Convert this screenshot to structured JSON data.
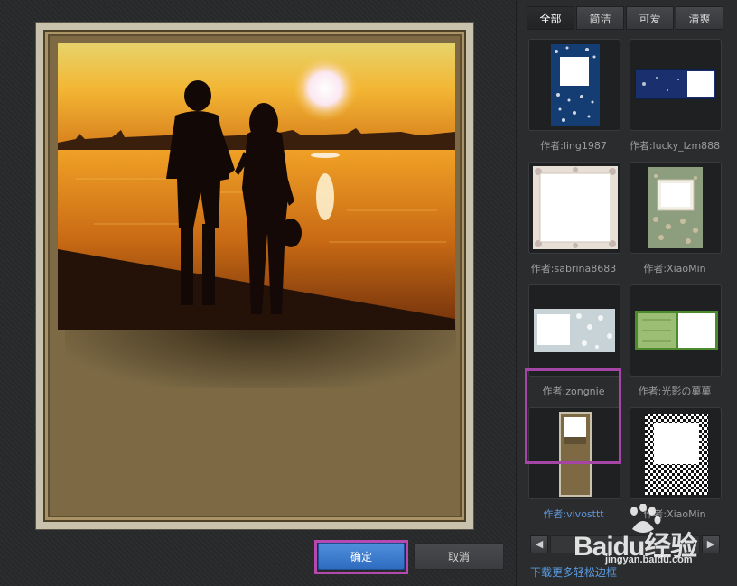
{
  "buttons": {
    "confirm": "确定",
    "cancel": "取消"
  },
  "tabs": [
    {
      "label": "全部",
      "active": true
    },
    {
      "label": "简洁",
      "active": false
    },
    {
      "label": "可爱",
      "active": false
    },
    {
      "label": "清爽",
      "active": false
    }
  ],
  "frames": [
    {
      "author": "作者:ling1987",
      "selected": false
    },
    {
      "author": "作者:lucky_lzm888",
      "selected": false
    },
    {
      "author": "作者:sabrina8683",
      "selected": false
    },
    {
      "author": "作者:XiaoMin",
      "selected": false
    },
    {
      "author": "作者:zongnie",
      "selected": false
    },
    {
      "author": "作者:光影の菓菓",
      "selected": false
    },
    {
      "author": "作者:vivosttt",
      "selected": true
    },
    {
      "author": "作者:XiaoMin",
      "selected": false
    }
  ],
  "pager": {
    "prev_icon": "◀",
    "next_icon": "▶"
  },
  "more_link": "下载更多轻松边框",
  "watermark": {
    "text": "Baidu经验",
    "url": "jingyan.baidu.com"
  },
  "colors": {
    "accent_highlight": "#b44ab0",
    "confirm_blue": "#3a7acb",
    "link_blue": "#5a9be0"
  }
}
